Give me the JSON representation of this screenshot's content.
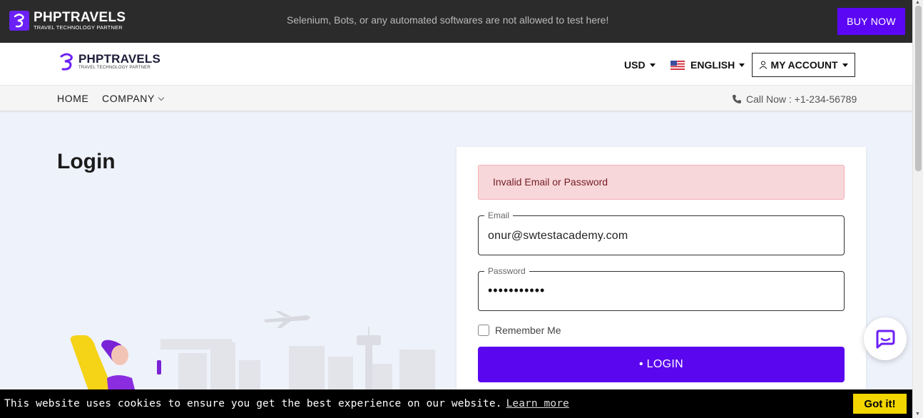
{
  "topbar": {
    "brand_title": "PHPTRAVELS",
    "brand_subtitle": "TRAVEL TECHNOLOGY PARTNER",
    "notice": "Selenium, Bots, or any automated softwares are not allowed to test here!",
    "buy_now": "BUY NOW"
  },
  "header": {
    "brand_title": "PHPTRAVELS",
    "brand_subtitle": "TRAVEL TECHNOLOGY PARTNER",
    "currency": "USD",
    "language": "ENGLISH",
    "account": "MY ACCOUNT"
  },
  "nav": {
    "home": "HOME",
    "company": "COMPANY",
    "call": "Call Now : +1-234-56789"
  },
  "main": {
    "title": "Login"
  },
  "form": {
    "alert": "Invalid Email or Password",
    "email_label": "Email",
    "email_value": "onur@swtestacademy.com",
    "password_label": "Password",
    "password_value": "•••••••••••",
    "remember_label": "Remember Me",
    "login_label": "• LOGIN"
  },
  "cookie": {
    "message": "This website uses cookies to ensure you get the best experience on our website.",
    "learn_more": "Learn more",
    "got_it": "Got it!"
  },
  "colors": {
    "brand_purple": "#5b06f5",
    "alert_bg": "#f8d7da",
    "cookie_button": "#f1d600"
  }
}
